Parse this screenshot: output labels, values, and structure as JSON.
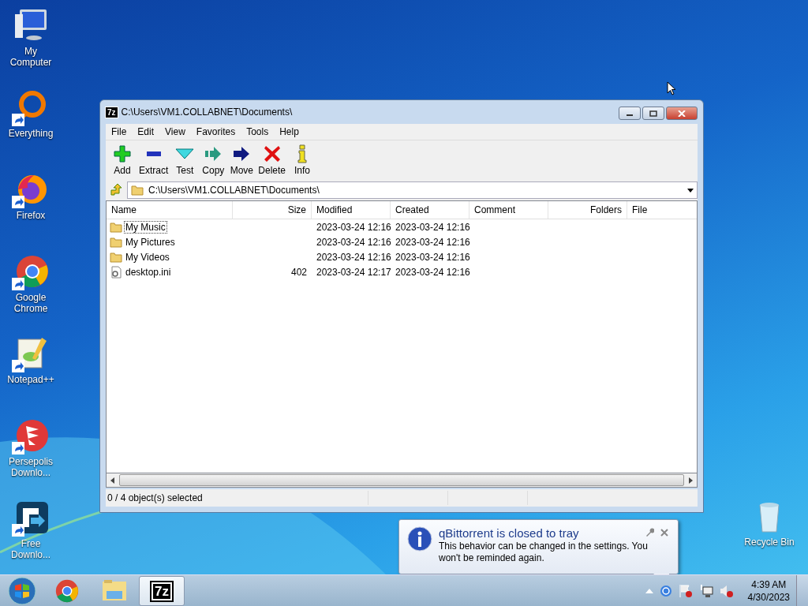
{
  "desktop_icons": [
    {
      "label": "My Computer",
      "kind": "computer",
      "shortcut": false
    },
    {
      "label": "Everything",
      "kind": "ring",
      "shortcut": true
    },
    {
      "label": "Firefox",
      "kind": "firefox",
      "shortcut": true
    },
    {
      "label": "Google Chrome",
      "kind": "chrome",
      "shortcut": true
    },
    {
      "label": "Notepad++",
      "kind": "notepad",
      "shortcut": true
    },
    {
      "label": "Persepolis Downlo...",
      "kind": "persepolis",
      "shortcut": true
    },
    {
      "label": "Free Downlo...",
      "kind": "download",
      "shortcut": true
    },
    {
      "label": "Recycle Bin",
      "kind": "bin",
      "shortcut": false
    }
  ],
  "window": {
    "logo": "7z",
    "title": "C:\\Users\\VM1.COLLABNET\\Documents\\",
    "menu": [
      "File",
      "Edit",
      "View",
      "Favorites",
      "Tools",
      "Help"
    ],
    "toolbar": [
      {
        "label": "Add",
        "kind": "add"
      },
      {
        "label": "Extract",
        "kind": "extract"
      },
      {
        "label": "Test",
        "kind": "test"
      },
      {
        "label": "Copy",
        "kind": "copy"
      },
      {
        "label": "Move",
        "kind": "move"
      },
      {
        "label": "Delete",
        "kind": "delete"
      },
      {
        "label": "Info",
        "kind": "info"
      }
    ],
    "address": "C:\\Users\\VM1.COLLABNET\\Documents\\",
    "columns": [
      "Name",
      "Size",
      "Modified",
      "Created",
      "Comment",
      "Folders",
      "File"
    ],
    "rows": [
      {
        "kind": "folder",
        "name": "My Music",
        "size": "",
        "modified": "2023-03-24 12:16",
        "created": "2023-03-24 12:16",
        "focused": true
      },
      {
        "kind": "folder",
        "name": "My Pictures",
        "size": "",
        "modified": "2023-03-24 12:16",
        "created": "2023-03-24 12:16",
        "focused": false
      },
      {
        "kind": "folder",
        "name": "My Videos",
        "size": "",
        "modified": "2023-03-24 12:16",
        "created": "2023-03-24 12:16",
        "focused": false
      },
      {
        "kind": "file",
        "name": "desktop.ini",
        "size": "402",
        "modified": "2023-03-24 12:17",
        "created": "2023-03-24 12:16",
        "focused": false
      }
    ],
    "status": "0 / 4 object(s) selected"
  },
  "notification": {
    "title": "qBittorrent is closed to tray",
    "message": "This behavior can be changed in the settings. You won't be reminded again."
  },
  "taskbar": {
    "apps": [
      {
        "kind": "chrome",
        "selected": false
      },
      {
        "kind": "explorer",
        "selected": false
      },
      {
        "kind": "sevenzip",
        "selected": true,
        "logo": "7z"
      }
    ],
    "time": "4:39 AM",
    "date": "4/30/2023"
  }
}
